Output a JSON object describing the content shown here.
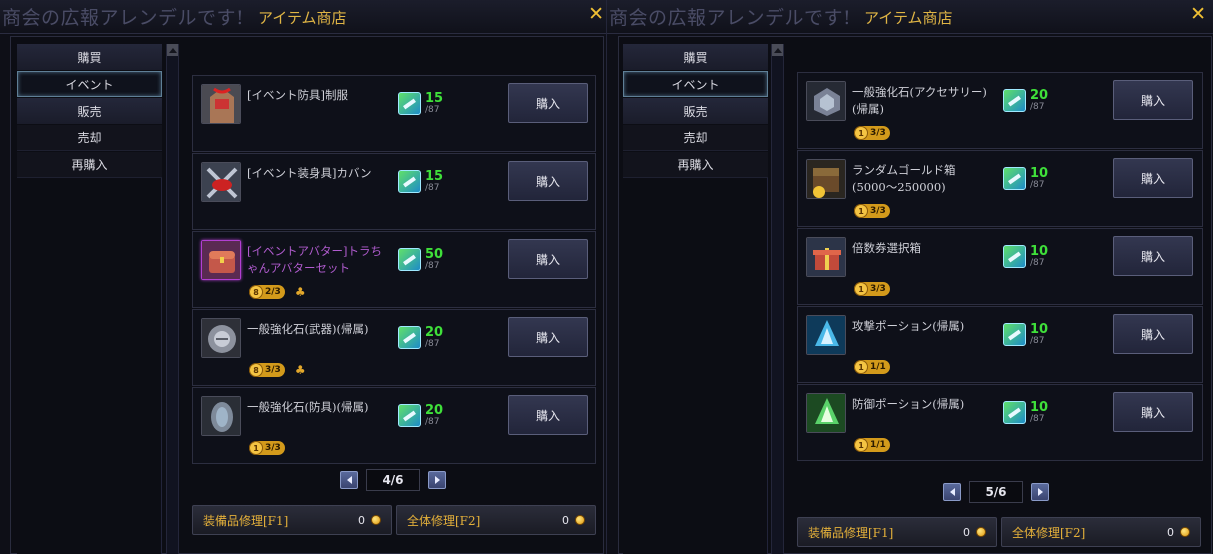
{
  "left": {
    "ghost": "商会の広報アレンデルです!",
    "title": "アイテム商店",
    "close": "✕",
    "sidebar": [
      "購買",
      "イベント",
      "販売",
      "売却",
      "再購入"
    ],
    "items": [
      {
        "name": "[イベント防具]制服",
        "price": "15",
        "max": "/87",
        "buy": "購入",
        "limit": "",
        "party": false,
        "purple": false,
        "icon": "uniform-icon"
      },
      {
        "name": "[イベント装身具]カバン",
        "price": "15",
        "max": "/87",
        "buy": "購入",
        "limit": "",
        "party": false,
        "purple": false,
        "icon": "bag-icon"
      },
      {
        "name": "[イベントアバター]トラちゃんアバターセット",
        "price": "50",
        "max": "/87",
        "buy": "購入",
        "limit": "2/3",
        "party": true,
        "purple": true,
        "icon": "chest-icon"
      },
      {
        "name": "一般強化石(武器)(帰属)",
        "price": "20",
        "max": "/87",
        "buy": "購入",
        "limit": "3/3",
        "party": true,
        "purple": false,
        "icon": "stone-icon"
      },
      {
        "name": "一般強化石(防具)(帰属)",
        "price": "20",
        "max": "/87",
        "buy": "購入",
        "limit": "3/3",
        "party": false,
        "purple": false,
        "icon": "armor-stone-icon"
      }
    ],
    "page": "4/6",
    "repair1": {
      "label": "装備品修理[F1]",
      "value": "0"
    },
    "repair2": {
      "label": "全体修理[F2]",
      "value": "0"
    }
  },
  "right": {
    "ghost": "商会の広報アレンデルです!",
    "title": "アイテム商店",
    "close": "✕",
    "sidebar": [
      "購買",
      "イベント",
      "販売",
      "売却",
      "再購入"
    ],
    "items": [
      {
        "name": "一般強化石(アクセサリー)(帰属)",
        "price": "20",
        "max": "/87",
        "buy": "購入",
        "limit": "3/3",
        "icon": "accessory-stone-icon"
      },
      {
        "name": "ランダムゴールド箱(5000〜250000)",
        "price": "10",
        "max": "/87",
        "buy": "購入",
        "limit": "3/3",
        "icon": "gold-box-icon"
      },
      {
        "name": "倍数券選択箱",
        "price": "10",
        "max": "/87",
        "buy": "購入",
        "limit": "3/3",
        "icon": "gift-box-icon"
      },
      {
        "name": "攻撃ポーション(帰属)",
        "price": "10",
        "max": "/87",
        "buy": "購入",
        "limit": "1/1",
        "icon": "attack-potion-icon"
      },
      {
        "name": "防御ポーション(帰属)",
        "price": "10",
        "max": "/87",
        "buy": "購入",
        "limit": "1/1",
        "icon": "defense-potion-icon"
      }
    ],
    "page": "5/6",
    "repair1": {
      "label": "装備品修理[F1]",
      "value": "0"
    },
    "repair2": {
      "label": "全体修理[F2]",
      "value": "0"
    }
  },
  "limit_badge_glyph": "1",
  "limit_badge_glyph_event": "8"
}
